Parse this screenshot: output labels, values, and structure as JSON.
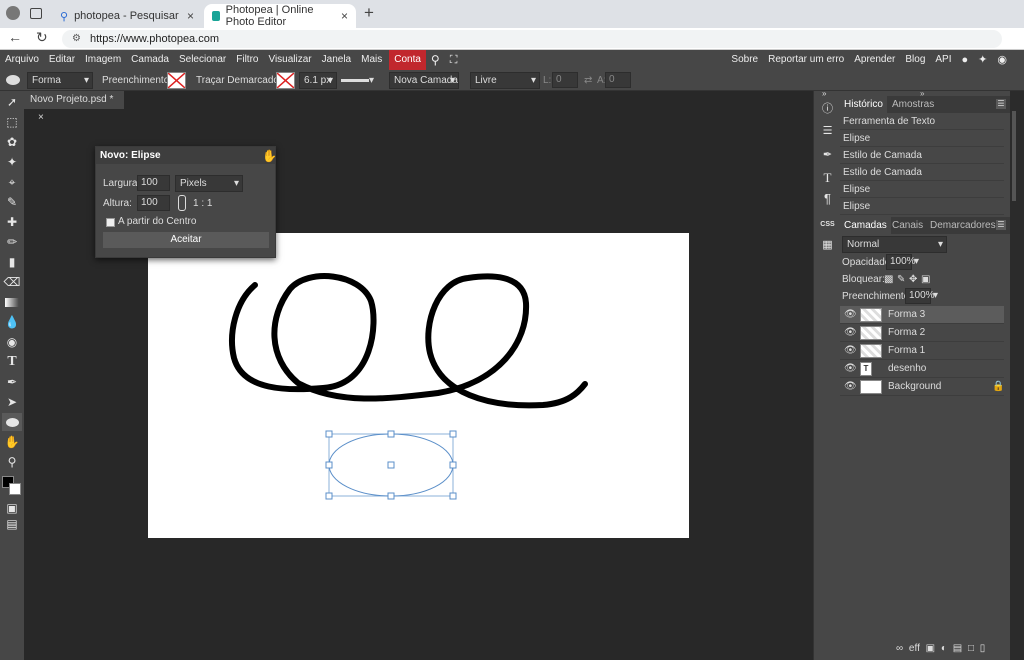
{
  "browser": {
    "tabs": [
      {
        "title": "photopea - Pesquisar",
        "close": "×"
      },
      {
        "title": "Photopea | Online Photo Editor",
        "close": "×"
      }
    ],
    "new_tab": "+",
    "url": "https://www.photopea.com"
  },
  "menu": {
    "left": [
      "Arquivo",
      "Editar",
      "Imagem",
      "Camada",
      "Selecionar",
      "Filtro",
      "Visualizar",
      "Janela",
      "Mais"
    ],
    "conta": "Conta",
    "right": [
      "Sobre",
      "Reportar um erro",
      "Aprender",
      "Blog",
      "API"
    ]
  },
  "options": {
    "shape": "Forma",
    "fill_label": "Preenchimento:",
    "stroke_label": "Traçar Demarcador:",
    "stroke_size": "6.1 px",
    "new_layer": "Nova Camada",
    "mode": "Livre",
    "l_label": "L:",
    "l_value": "0",
    "a_label": "A:",
    "a_value": "0"
  },
  "document": {
    "tab": "Novo Projeto.psd *",
    "close": "×"
  },
  "dialog": {
    "title": "Novo: Elipse",
    "width_label": "Largura:",
    "width_value": "100",
    "unit": "Pixels",
    "height_label": "Altura:",
    "height_value": "100",
    "ratio": "1 : 1",
    "center_label": "A partir do Centro",
    "accept": "Aceitar"
  },
  "history_panel": {
    "tabs": [
      "Histórico",
      "Amostras"
    ],
    "items": [
      "Ferramenta de Texto",
      "Elipse",
      "Estilo de Camada",
      "Estilo de Camada",
      "Elipse",
      "Elipse"
    ]
  },
  "layers_panel": {
    "tabs": [
      "Camadas",
      "Canais",
      "Demarcadores"
    ],
    "blend": "Normal",
    "opacity_label": "Opacidade:",
    "opacity": "100%",
    "lock_label": "Bloquear:",
    "fill_label": "Preenchimento:",
    "fill": "100%",
    "layers": [
      "Forma 3",
      "Forma 2",
      "Forma 1",
      "desenho",
      "Background"
    ],
    "text_thumb": "T",
    "footer": "eff"
  },
  "colors": {
    "accent_conta": "#c1272d",
    "panel": "#474747",
    "canvas_bg": "#282828",
    "selection": "#5b8fc9"
  }
}
